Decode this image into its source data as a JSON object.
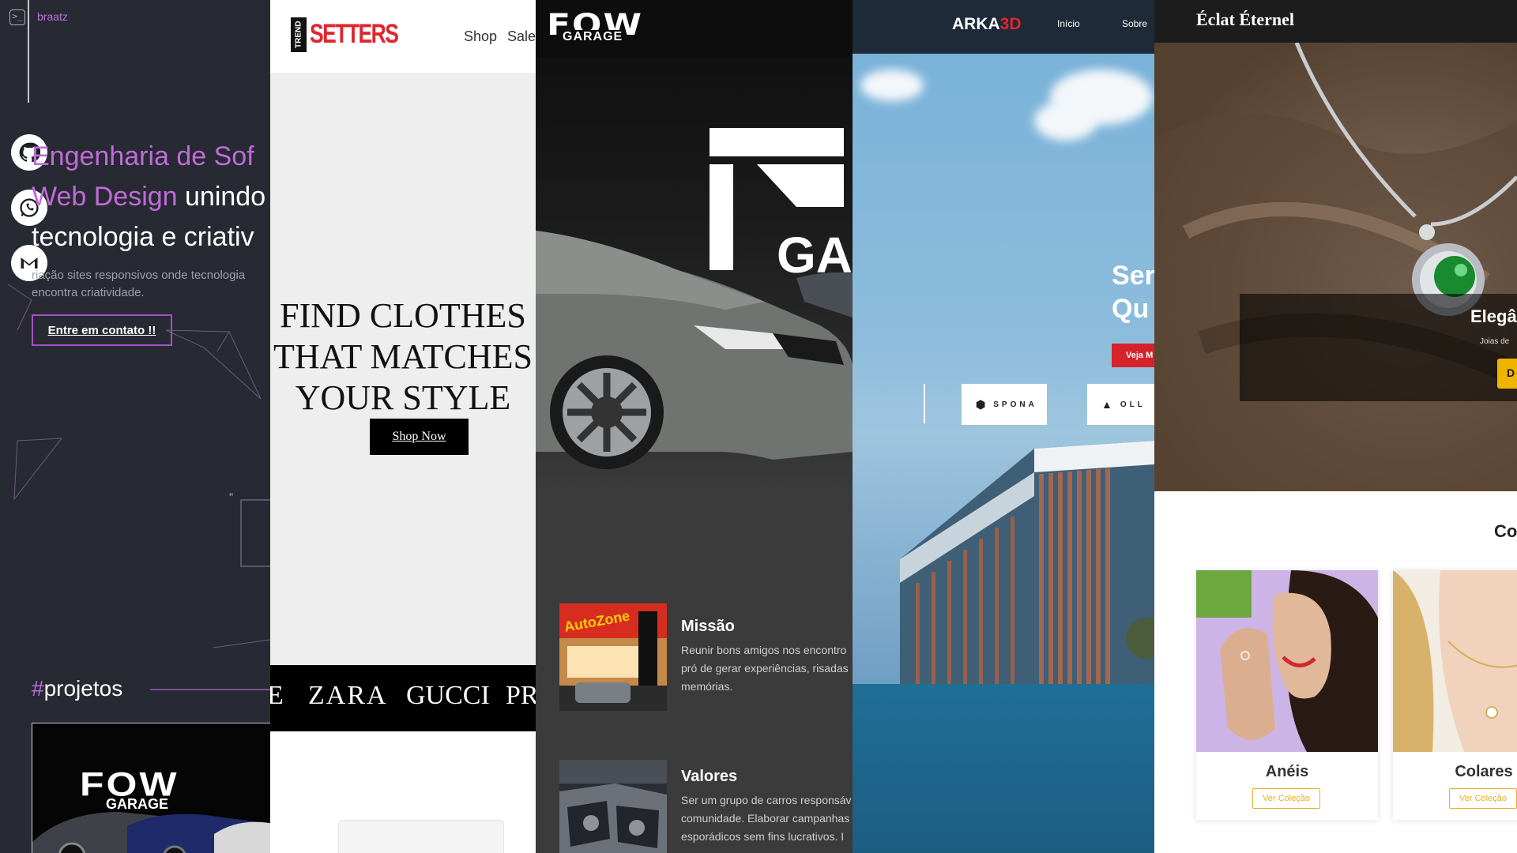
{
  "colors": {
    "portfolio_bg": "#282a33",
    "portfolio_accent": "#c06bd9",
    "trend_red": "#e0262d",
    "fow_bg": "#3b3b3b",
    "arka_red": "#e0262d",
    "eclat_gold": "#e7b02a"
  },
  "portfolio": {
    "brand": "braatz",
    "icons": [
      "terminal-icon",
      "github-icon",
      "whatsapp-icon",
      "gmail-icon"
    ],
    "headline_line1_accent": "Engenharia de Sof",
    "headline_line2_accent": "Web Design",
    "headline_line2_rest": " unindo",
    "headline_line3": "tecnologia e criativ",
    "description": "riação sites responsivos onde tecnologia encontra criatividade.",
    "cta": "Entre em contato !!",
    "quote_mark": "“",
    "projects_hash": "#",
    "projects_title": "projetos",
    "thumb_logo": "FOW",
    "thumb_sub": "GARAGE"
  },
  "trendsetters": {
    "logo_box": "TREND",
    "logo_text": "SETTERS",
    "nav": [
      "Shop",
      "Sale"
    ],
    "hero_lines": [
      "FIND CLOTHES",
      "THAT MATCHES",
      "YOUR STYLE"
    ],
    "cta": "Shop Now",
    "brands": [
      "E",
      "ZARA",
      "GUCCI",
      "PR"
    ]
  },
  "fowgarage": {
    "logo": "FOW",
    "logo_sub": "GARAGE",
    "big_logo_sub": "GA",
    "cards": [
      {
        "title": "Missão",
        "text": [
          "Reunir bons amigos nos encontro",
          "pró de gerar experiências, risadas",
          "memórias."
        ]
      },
      {
        "title": "Valores",
        "text": [
          "Ser um grupo de carros responsáv",
          "comunidade. Elaborar campanhas",
          "esporádicos sem fins lucrativos. I"
        ]
      }
    ],
    "storefront_sign": "AutoZone"
  },
  "arka": {
    "logo": "ARKA",
    "logo_red": "3D",
    "nav": [
      "Início",
      "Sobre"
    ],
    "hero_lines": [
      "Ser",
      "Qu"
    ],
    "cta": "Veja M",
    "partners": [
      "SPONA",
      "OLL"
    ]
  },
  "eclat": {
    "logo": "Éclat Éternel",
    "hero_title": "Elegâ",
    "hero_sub": "Joias de",
    "hero_btn": "D",
    "section_title": "Co",
    "categories": [
      {
        "name": "Anéis",
        "button": "Ver Coleção"
      },
      {
        "name": "Colares",
        "button": "Ver Coleção"
      }
    ]
  }
}
